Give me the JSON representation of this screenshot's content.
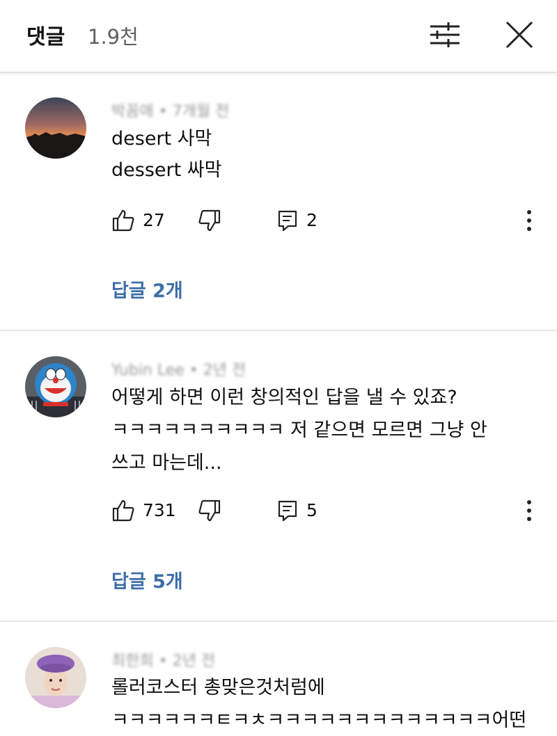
{
  "header": {
    "title": "댓글",
    "count": "1.9천",
    "filter_icon": "sliders-icon",
    "close_icon": "close-icon"
  },
  "comments": [
    {
      "author": "박꼼애",
      "time": "7개월 전",
      "lines": [
        "desert 사막",
        "dessert 싸막"
      ],
      "likes": "27",
      "replies": "2",
      "replies_label": "답글 2개"
    },
    {
      "author": "Yubin Lee",
      "time": "2년 전",
      "lines": [
        "어떻게 하면 이런 창의적인 답을 낼 수 있죠?",
        "ㅋㅋㅋㅋㅋㅋㅋㅋㅋㅋ 저 같으면 모르면 그냥 안",
        "쓰고 마는데..."
      ],
      "likes": "731",
      "replies": "5",
      "replies_label": "답글 5개"
    },
    {
      "author": "최한희",
      "time": "2년 전",
      "lines": [
        "롤러코스터 총맞은것처럼에",
        "ㅋㅋㅋㅋㅋㅋㅌㅋㅊㅋㅋㅋㅋㅋㅋㅋㅋㅋㅋㅋㅋㅋ어떤"
      ]
    }
  ],
  "colors": {
    "link": "#3e6ea8",
    "meta": "#9a9a9a",
    "divider": "#e6e6e6"
  }
}
